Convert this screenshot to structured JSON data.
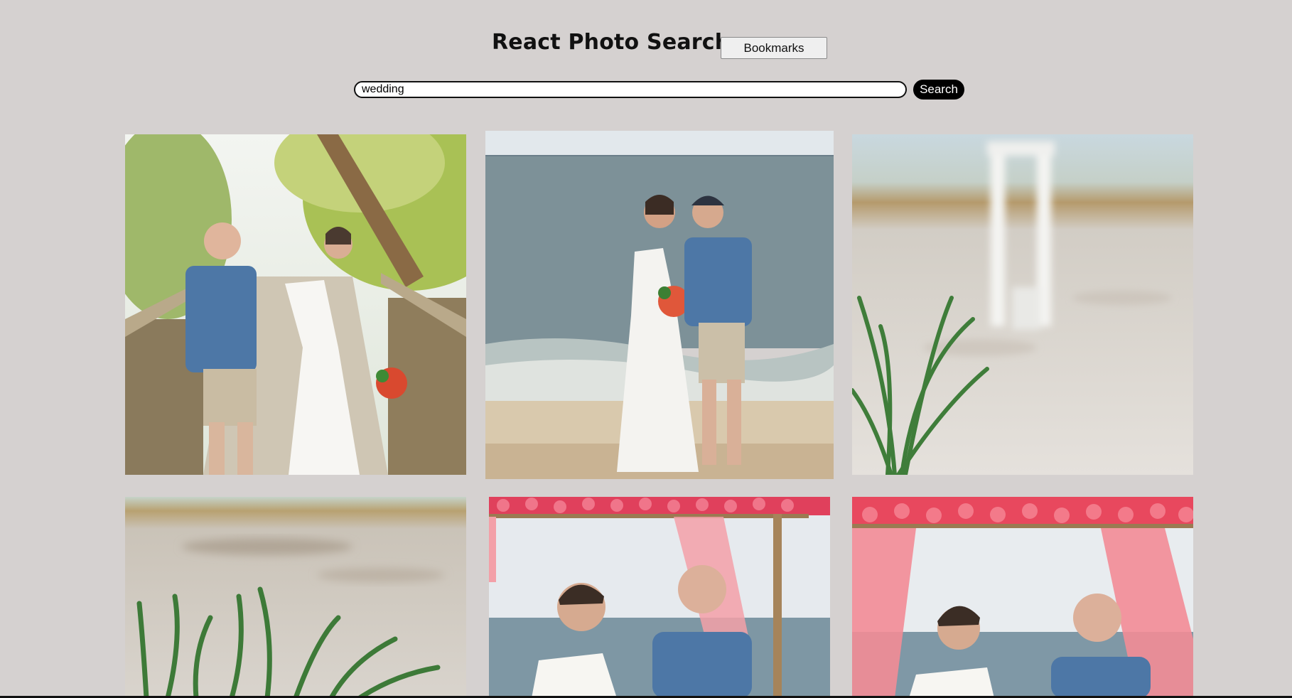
{
  "header": {
    "title": "React Photo Search",
    "bookmarks_label": "Bookmarks"
  },
  "search": {
    "value": "wedding",
    "button_label": "Search"
  },
  "photos": [
    {
      "subject": "couple holding hands on wooden boardwalk"
    },
    {
      "subject": "couple posing on beach shore"
    },
    {
      "subject": "blurred white arbor on sand with grass"
    },
    {
      "subject": "blurred sand and beach grass"
    },
    {
      "subject": "ceremony under pink floral arch"
    },
    {
      "subject": "couple facing each other under floral arch"
    }
  ],
  "colors": {
    "background": "#d5d1d0",
    "search_button": "#000000"
  }
}
